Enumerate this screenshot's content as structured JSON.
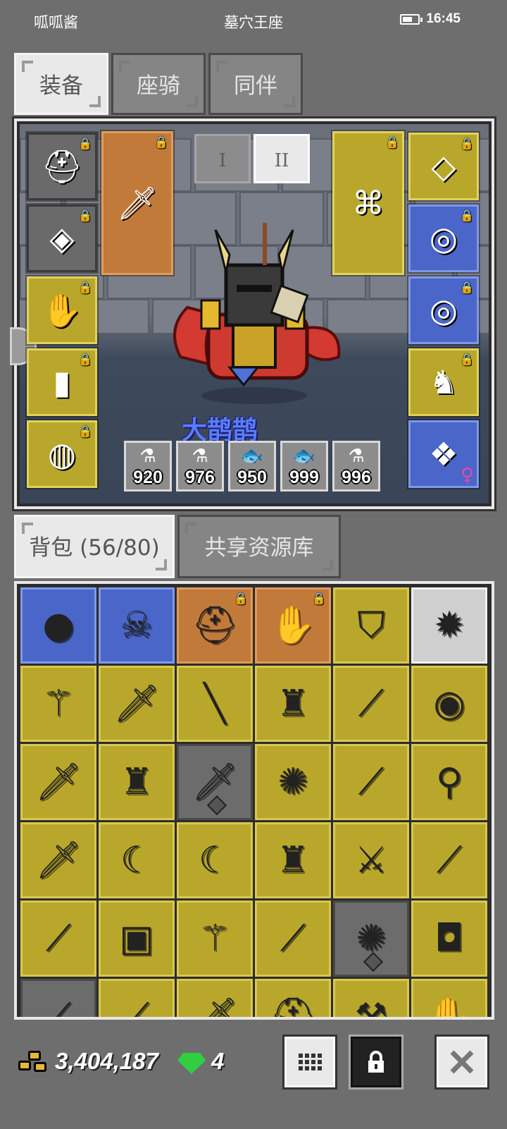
{
  "status_bar": {
    "left_label": "呱呱酱",
    "center_label": "墓穴王座",
    "time": "16:45",
    "battery_level": 0.6
  },
  "top_tabs": [
    {
      "label": "装备",
      "active": true
    },
    {
      "label": "座骑",
      "active": false
    },
    {
      "label": "同伴",
      "active": false
    }
  ],
  "equipment": {
    "page_buttons": {
      "page_one": "I",
      "page_two": "II"
    },
    "character_name": "大鹊鹊",
    "left_slots": [
      {
        "name": "helmet",
        "icon": "horned-helmet-icon",
        "rarity": "gray",
        "locked": true,
        "glyph": "⛑"
      },
      {
        "name": "armor",
        "icon": "chest-armor-icon",
        "rarity": "gray",
        "locked": true,
        "glyph": "◈"
      },
      {
        "name": "gloves",
        "icon": "gauntlet-icon",
        "rarity": "yellow",
        "locked": true,
        "glyph": "✋"
      },
      {
        "name": "leggings",
        "icon": "leggings-icon",
        "rarity": "yellow",
        "locked": true,
        "glyph": "▮"
      },
      {
        "name": "boots",
        "icon": "belt-icon",
        "rarity": "yellow",
        "locked": true,
        "glyph": "◍"
      }
    ],
    "weapon_slot": {
      "icon": "golden-sword-icon",
      "rarity": "orange",
      "locked": true,
      "glyph": "🗡"
    },
    "offhand_slot": {
      "icon": "bone-shield-icon",
      "rarity": "yellow",
      "locked": true,
      "glyph": "⌘"
    },
    "right_slots": [
      {
        "name": "necklace",
        "icon": "sapphire-necklace-icon",
        "rarity": "yellow",
        "locked": true,
        "glyph": "◇"
      },
      {
        "name": "ring-1",
        "icon": "ruby-ring-icon",
        "rarity": "blue",
        "locked": true,
        "glyph": "◎"
      },
      {
        "name": "ring-2",
        "icon": "ruby-ring-icon",
        "rarity": "blue",
        "locked": true,
        "glyph": "◎"
      },
      {
        "name": "mount",
        "icon": "red-dragon-icon",
        "rarity": "yellow",
        "locked": true,
        "glyph": "♞"
      },
      {
        "name": "companion",
        "icon": "blue-bird-icon",
        "rarity": "blue",
        "locked": false,
        "glyph": "❖",
        "gender": "♀"
      }
    ],
    "consumables": [
      {
        "icon": "potion-icon",
        "glyph": "⚗",
        "count": "920"
      },
      {
        "icon": "potion-icon",
        "glyph": "⚗",
        "count": "976"
      },
      {
        "icon": "fish-icon",
        "glyph": "🐟",
        "count": "950"
      },
      {
        "icon": "fish-icon",
        "glyph": "🐟",
        "count": "999"
      },
      {
        "icon": "potion-icon",
        "glyph": "⚗",
        "count": "996"
      }
    ]
  },
  "inventory_tabs": [
    {
      "label": "背包 (56/80)",
      "active": true
    },
    {
      "label": "共享资源库",
      "active": false
    }
  ],
  "inventory": [
    {
      "icon": "rock-icon",
      "rarity": "blue",
      "glyph": "●",
      "locked": false,
      "marked": false
    },
    {
      "icon": "skull-mask-icon",
      "rarity": "blue",
      "glyph": "☠",
      "locked": false,
      "marked": false
    },
    {
      "icon": "red-helmet-icon",
      "rarity": "orange",
      "glyph": "⛑",
      "locked": true,
      "marked": false
    },
    {
      "icon": "red-gauntlet-icon",
      "rarity": "orange",
      "glyph": "✋",
      "locked": true,
      "marked": false
    },
    {
      "icon": "shield-icon",
      "rarity": "yellow",
      "glyph": "⛉",
      "locked": false,
      "marked": false
    },
    {
      "icon": "spiked-ball-icon",
      "rarity": "white",
      "glyph": "✹",
      "locked": false,
      "marked": false
    },
    {
      "icon": "trident-icon",
      "rarity": "yellow",
      "glyph": "⚚",
      "locked": false,
      "marked": false
    },
    {
      "icon": "dagger-icon",
      "rarity": "yellow",
      "glyph": "🗡",
      "locked": false,
      "marked": false
    },
    {
      "icon": "staff-icon",
      "rarity": "yellow",
      "glyph": "╲",
      "locked": false,
      "marked": false
    },
    {
      "icon": "red-armor-icon",
      "rarity": "yellow",
      "glyph": "♜",
      "locked": false,
      "marked": false
    },
    {
      "icon": "bone-dagger-icon",
      "rarity": "yellow",
      "glyph": "⟋",
      "locked": false,
      "marked": false
    },
    {
      "icon": "round-shield-icon",
      "rarity": "yellow",
      "glyph": "◉",
      "locked": false,
      "marked": false
    },
    {
      "icon": "knife-icon",
      "rarity": "yellow",
      "glyph": "🗡",
      "locked": false,
      "marked": false
    },
    {
      "icon": "red-armor-icon",
      "rarity": "yellow",
      "glyph": "♜",
      "locked": false,
      "marked": false
    },
    {
      "icon": "knife-icon",
      "rarity": "gray",
      "glyph": "🗡",
      "locked": false,
      "marked": true
    },
    {
      "icon": "morning-star-icon",
      "rarity": "yellow",
      "glyph": "✺",
      "locked": false,
      "marked": false
    },
    {
      "icon": "bone-dagger-icon",
      "rarity": "yellow",
      "glyph": "⟋",
      "locked": false,
      "marked": false
    },
    {
      "icon": "mace-icon",
      "rarity": "yellow",
      "glyph": "⚲",
      "locked": false,
      "marked": false
    },
    {
      "icon": "dagger-icon",
      "rarity": "yellow",
      "glyph": "🗡",
      "locked": false,
      "marked": false
    },
    {
      "icon": "scythe-icon",
      "rarity": "yellow",
      "glyph": "☾",
      "locked": false,
      "marked": false
    },
    {
      "icon": "scythe-icon",
      "rarity": "yellow",
      "glyph": "☾",
      "locked": false,
      "marked": false
    },
    {
      "icon": "red-armor-icon",
      "rarity": "yellow",
      "glyph": "♜",
      "locked": false,
      "marked": false
    },
    {
      "icon": "long-sword-icon",
      "rarity": "yellow",
      "glyph": "⚔",
      "locked": false,
      "marked": false
    },
    {
      "icon": "spear-icon",
      "rarity": "yellow",
      "glyph": "⟋",
      "locked": false,
      "marked": false
    },
    {
      "icon": "spear-icon",
      "rarity": "yellow",
      "glyph": "⟋",
      "locked": false,
      "marked": false
    },
    {
      "icon": "chainmail-icon",
      "rarity": "yellow",
      "glyph": "▣",
      "locked": false,
      "marked": false
    },
    {
      "icon": "trident-icon",
      "rarity": "yellow",
      "glyph": "⚚",
      "locked": false,
      "marked": false
    },
    {
      "icon": "spear-icon",
      "rarity": "yellow",
      "glyph": "⟋",
      "locked": false,
      "marked": false
    },
    {
      "icon": "morning-star-icon",
      "rarity": "gray",
      "glyph": "✺",
      "locked": false,
      "marked": true
    },
    {
      "icon": "dark-armor-icon",
      "rarity": "yellow",
      "glyph": "◘",
      "locked": false,
      "marked": false
    },
    {
      "icon": "bow-icon",
      "rarity": "gray",
      "glyph": "⟋",
      "locked": false,
      "marked": false
    },
    {
      "icon": "bow-icon",
      "rarity": "yellow",
      "glyph": "⟋",
      "locked": false,
      "marked": false
    },
    {
      "icon": "dagger-icon",
      "rarity": "yellow",
      "glyph": "🗡",
      "locked": false,
      "marked": false
    },
    {
      "icon": "helmet-icon",
      "rarity": "yellow",
      "glyph": "⛑",
      "locked": false,
      "marked": false
    },
    {
      "icon": "axe-icon",
      "rarity": "yellow",
      "glyph": "⚒",
      "locked": false,
      "marked": false
    },
    {
      "icon": "claw-icon",
      "rarity": "yellow",
      "glyph": "✋",
      "locked": false,
      "marked": false
    }
  ],
  "currency": {
    "gold_icon": "gold-ore-icon",
    "gold": "3,404,187",
    "gem_icon": "emerald-icon",
    "gems": "4"
  },
  "colors": {
    "rarity_gray": "#6a6a6a",
    "rarity_yellow": "#b9a72c",
    "rarity_orange": "#c27a3a",
    "rarity_blue": "#4a66c9",
    "rarity_white": "#cfcfcf"
  }
}
